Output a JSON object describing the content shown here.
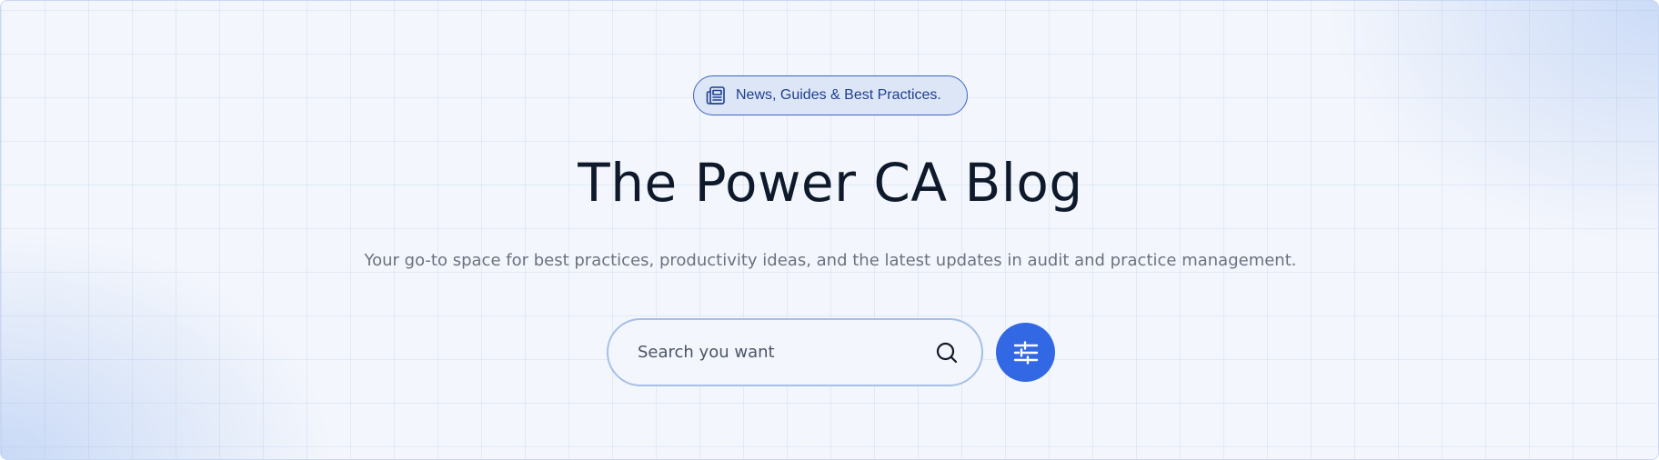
{
  "badge": {
    "icon": "newspaper-icon",
    "label": "News, Guides & Best Practices."
  },
  "hero": {
    "title": "The Power CA Blog",
    "subtitle": "Your go-to space for best practices, productivity ideas, and the latest updates in audit and practice management."
  },
  "search": {
    "placeholder": "Search you want",
    "value": "",
    "icon": "search-icon"
  },
  "filter_button": {
    "icon": "sliders-icon"
  },
  "colors": {
    "accent": "#3268e3",
    "badge_border": "#3b63c4",
    "badge_text": "#1e3f8f",
    "title": "#0e1a2b",
    "subtitle": "#6b7280",
    "background": "#f3f6fc"
  }
}
